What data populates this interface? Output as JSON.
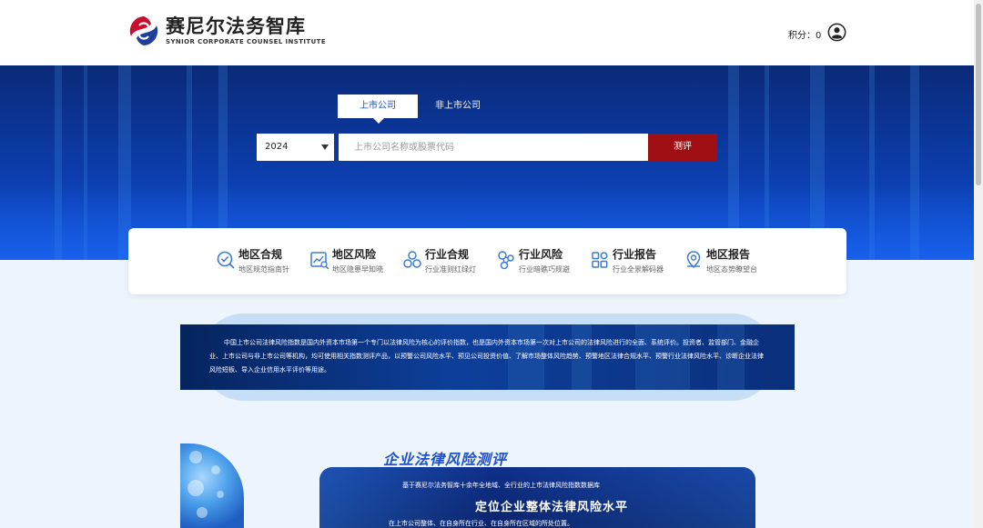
{
  "brand": {
    "name_cn": "赛尼尔法务智库",
    "name_en": "SYNIOR CORPORATE COUNSEL INSTITUTE",
    "colors": {
      "red": "#c8102e",
      "blue": "#1e3f9a"
    }
  },
  "header": {
    "points_label": "积分：0",
    "user_icon": "user-circle-icon"
  },
  "search": {
    "tabs": [
      {
        "label": "上市公司",
        "active": true
      },
      {
        "label": "非上市公司",
        "active": false
      }
    ],
    "year": "2024",
    "placeholder": "上市公司名称或股票代码",
    "submit_label": "测评"
  },
  "nav": {
    "items": [
      {
        "title": "地区合规",
        "subtitle": "地区规范指南针",
        "icon": "compliance-check-icon"
      },
      {
        "title": "地区风险",
        "subtitle": "地区隐患早知晓",
        "icon": "risk-chart-icon"
      },
      {
        "title": "行业合规",
        "subtitle": "行业准则红绿灯",
        "icon": "industry-circles-icon"
      },
      {
        "title": "行业风险",
        "subtitle": "行业暗礁巧规避",
        "icon": "network-icon"
      },
      {
        "title": "行业报告",
        "subtitle": "行业全景解码器",
        "icon": "grid-report-icon"
      },
      {
        "title": "地区报告",
        "subtitle": "地区态势瞭望台",
        "icon": "map-pin-icon"
      }
    ]
  },
  "intro": {
    "text": "中国上市公司法律风险指数是国内外资本市场第一个专门以法律风险为核心的评价指数，也是国内外资本市场第一次对上市公司的法律风险进行的全面、系统评价。投资者、监管部门、金融企业、上市公司与非上市公司等机构，均可使用相关指数测评产品，以预警公司风险水平、预见公司投资价值、了解市场整体风险趋势、预警地区法律合规水平、预警行业法律风险水平、诊断企业法律风险短板、导入企业信用水平评价等用途。"
  },
  "section": {
    "title": "企业法律风险测评",
    "promo_sub": "基于赛尼尔法务智库十余年全地域、全行业的上市法律风险指数数据库",
    "promo_main": "定位企业整体法律风险水平",
    "promo_note": "在上市公司整体、在自身所在行业、在自身所在区域的所处位置。"
  }
}
